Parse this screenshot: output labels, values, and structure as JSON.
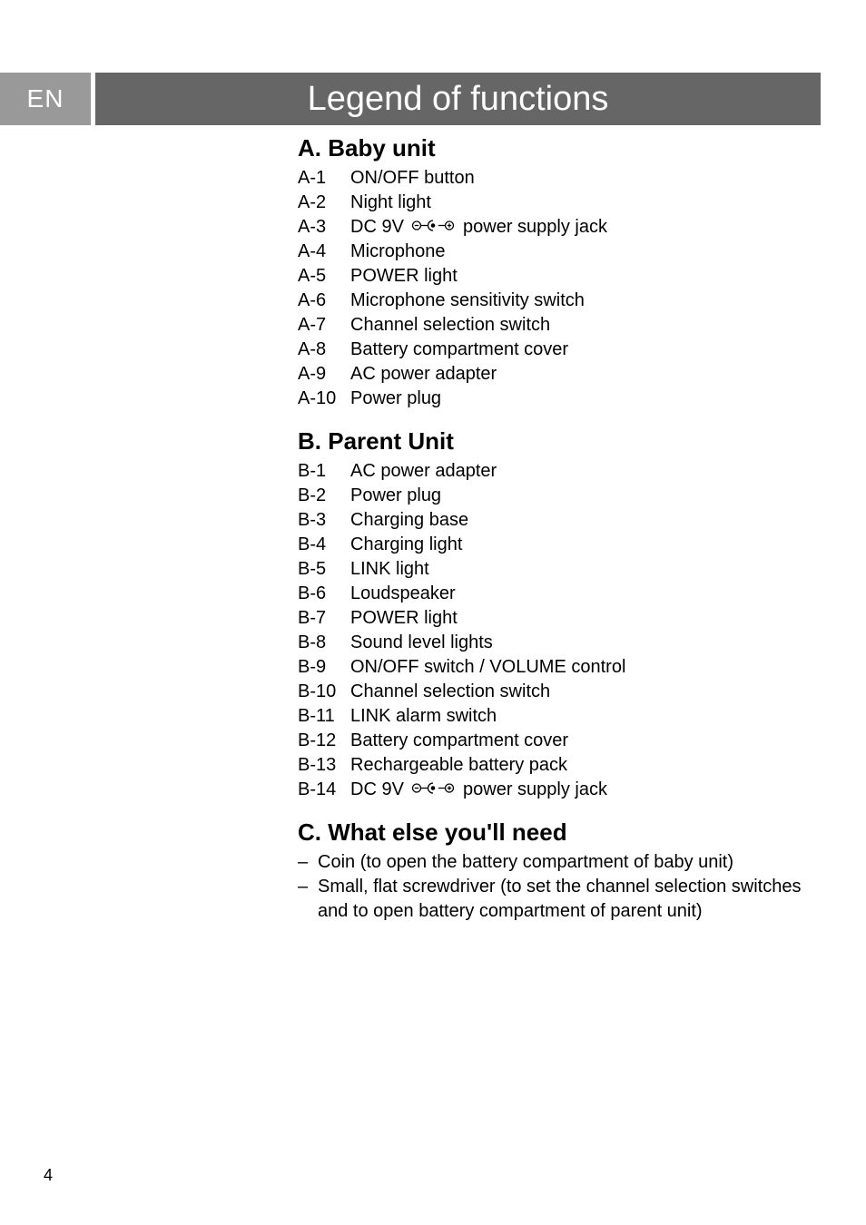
{
  "langTab": "EN",
  "pageTitle": "Legend of functions",
  "sections": [
    {
      "heading": "A. Baby unit",
      "items": [
        {
          "id": "A-1",
          "desc": "ON/OFF button"
        },
        {
          "id": "A-2",
          "desc": "Night light"
        },
        {
          "id": "A-3",
          "prefix": "DC 9V ",
          "hasDcIcon": true,
          "suffix": " power supply jack"
        },
        {
          "id": "A-4",
          "desc": "Microphone"
        },
        {
          "id": "A-5",
          "desc": "POWER light"
        },
        {
          "id": "A-6",
          "desc": "Microphone sensitivity switch"
        },
        {
          "id": "A-7",
          "desc": "Channel selection switch"
        },
        {
          "id": "A-8",
          "desc": "Battery compartment cover"
        },
        {
          "id": "A-9",
          "desc": "AC power adapter"
        },
        {
          "id": "A-10",
          "desc": "Power plug"
        }
      ]
    },
    {
      "heading": "B. Parent Unit",
      "items": [
        {
          "id": "B-1",
          "desc": "AC power adapter"
        },
        {
          "id": "B-2",
          "desc": "Power plug"
        },
        {
          "id": "B-3",
          "desc": "Charging base"
        },
        {
          "id": "B-4",
          "desc": "Charging light"
        },
        {
          "id": "B-5",
          "desc": "LINK light"
        },
        {
          "id": "B-6",
          "desc": "Loudspeaker"
        },
        {
          "id": "B-7",
          "desc": "POWER light"
        },
        {
          "id": "B-8",
          "desc": "Sound level lights"
        },
        {
          "id": "B-9",
          "desc": "ON/OFF switch / VOLUME control"
        },
        {
          "id": "B-10",
          "desc": "Channel selection switch"
        },
        {
          "id": "B-11",
          "desc": "LINK alarm switch"
        },
        {
          "id": "B-12",
          "desc": "Battery compartment cover"
        },
        {
          "id": "B-13",
          "desc": "Rechargeable battery pack"
        },
        {
          "id": "B-14",
          "prefix": "DC 9V ",
          "hasDcIcon": true,
          "suffix": " power supply jack"
        }
      ]
    },
    {
      "heading": "C. What else you'll need",
      "bullets": [
        "Coin (to open the battery compartment of baby unit)",
        "Small, flat screwdriver (to set the channel selection switches and to open battery compartment of parent unit)"
      ]
    }
  ],
  "pageNumber": "4",
  "bulletMark": "–"
}
